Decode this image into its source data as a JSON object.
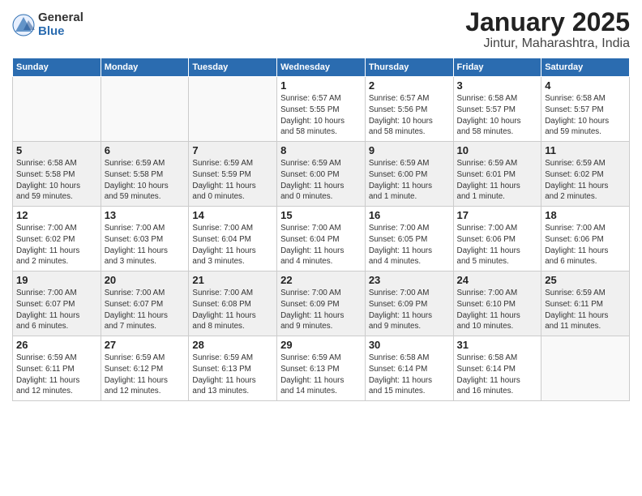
{
  "logo": {
    "general": "General",
    "blue": "Blue"
  },
  "header": {
    "title": "January 2025",
    "subtitle": "Jintur, Maharashtra, India"
  },
  "weekdays": [
    "Sunday",
    "Monday",
    "Tuesday",
    "Wednesday",
    "Thursday",
    "Friday",
    "Saturday"
  ],
  "weeks": [
    [
      {
        "day": "",
        "info": ""
      },
      {
        "day": "",
        "info": ""
      },
      {
        "day": "",
        "info": ""
      },
      {
        "day": "1",
        "info": "Sunrise: 6:57 AM\nSunset: 5:55 PM\nDaylight: 10 hours\nand 58 minutes."
      },
      {
        "day": "2",
        "info": "Sunrise: 6:57 AM\nSunset: 5:56 PM\nDaylight: 10 hours\nand 58 minutes."
      },
      {
        "day": "3",
        "info": "Sunrise: 6:58 AM\nSunset: 5:57 PM\nDaylight: 10 hours\nand 58 minutes."
      },
      {
        "day": "4",
        "info": "Sunrise: 6:58 AM\nSunset: 5:57 PM\nDaylight: 10 hours\nand 59 minutes."
      }
    ],
    [
      {
        "day": "5",
        "info": "Sunrise: 6:58 AM\nSunset: 5:58 PM\nDaylight: 10 hours\nand 59 minutes."
      },
      {
        "day": "6",
        "info": "Sunrise: 6:59 AM\nSunset: 5:58 PM\nDaylight: 10 hours\nand 59 minutes."
      },
      {
        "day": "7",
        "info": "Sunrise: 6:59 AM\nSunset: 5:59 PM\nDaylight: 11 hours\nand 0 minutes."
      },
      {
        "day": "8",
        "info": "Sunrise: 6:59 AM\nSunset: 6:00 PM\nDaylight: 11 hours\nand 0 minutes."
      },
      {
        "day": "9",
        "info": "Sunrise: 6:59 AM\nSunset: 6:00 PM\nDaylight: 11 hours\nand 1 minute."
      },
      {
        "day": "10",
        "info": "Sunrise: 6:59 AM\nSunset: 6:01 PM\nDaylight: 11 hours\nand 1 minute."
      },
      {
        "day": "11",
        "info": "Sunrise: 6:59 AM\nSunset: 6:02 PM\nDaylight: 11 hours\nand 2 minutes."
      }
    ],
    [
      {
        "day": "12",
        "info": "Sunrise: 7:00 AM\nSunset: 6:02 PM\nDaylight: 11 hours\nand 2 minutes."
      },
      {
        "day": "13",
        "info": "Sunrise: 7:00 AM\nSunset: 6:03 PM\nDaylight: 11 hours\nand 3 minutes."
      },
      {
        "day": "14",
        "info": "Sunrise: 7:00 AM\nSunset: 6:04 PM\nDaylight: 11 hours\nand 3 minutes."
      },
      {
        "day": "15",
        "info": "Sunrise: 7:00 AM\nSunset: 6:04 PM\nDaylight: 11 hours\nand 4 minutes."
      },
      {
        "day": "16",
        "info": "Sunrise: 7:00 AM\nSunset: 6:05 PM\nDaylight: 11 hours\nand 4 minutes."
      },
      {
        "day": "17",
        "info": "Sunrise: 7:00 AM\nSunset: 6:06 PM\nDaylight: 11 hours\nand 5 minutes."
      },
      {
        "day": "18",
        "info": "Sunrise: 7:00 AM\nSunset: 6:06 PM\nDaylight: 11 hours\nand 6 minutes."
      }
    ],
    [
      {
        "day": "19",
        "info": "Sunrise: 7:00 AM\nSunset: 6:07 PM\nDaylight: 11 hours\nand 6 minutes."
      },
      {
        "day": "20",
        "info": "Sunrise: 7:00 AM\nSunset: 6:07 PM\nDaylight: 11 hours\nand 7 minutes."
      },
      {
        "day": "21",
        "info": "Sunrise: 7:00 AM\nSunset: 6:08 PM\nDaylight: 11 hours\nand 8 minutes."
      },
      {
        "day": "22",
        "info": "Sunrise: 7:00 AM\nSunset: 6:09 PM\nDaylight: 11 hours\nand 9 minutes."
      },
      {
        "day": "23",
        "info": "Sunrise: 7:00 AM\nSunset: 6:09 PM\nDaylight: 11 hours\nand 9 minutes."
      },
      {
        "day": "24",
        "info": "Sunrise: 7:00 AM\nSunset: 6:10 PM\nDaylight: 11 hours\nand 10 minutes."
      },
      {
        "day": "25",
        "info": "Sunrise: 6:59 AM\nSunset: 6:11 PM\nDaylight: 11 hours\nand 11 minutes."
      }
    ],
    [
      {
        "day": "26",
        "info": "Sunrise: 6:59 AM\nSunset: 6:11 PM\nDaylight: 11 hours\nand 12 minutes."
      },
      {
        "day": "27",
        "info": "Sunrise: 6:59 AM\nSunset: 6:12 PM\nDaylight: 11 hours\nand 12 minutes."
      },
      {
        "day": "28",
        "info": "Sunrise: 6:59 AM\nSunset: 6:13 PM\nDaylight: 11 hours\nand 13 minutes."
      },
      {
        "day": "29",
        "info": "Sunrise: 6:59 AM\nSunset: 6:13 PM\nDaylight: 11 hours\nand 14 minutes."
      },
      {
        "day": "30",
        "info": "Sunrise: 6:58 AM\nSunset: 6:14 PM\nDaylight: 11 hours\nand 15 minutes."
      },
      {
        "day": "31",
        "info": "Sunrise: 6:58 AM\nSunset: 6:14 PM\nDaylight: 11 hours\nand 16 minutes."
      },
      {
        "day": "",
        "info": ""
      }
    ]
  ]
}
